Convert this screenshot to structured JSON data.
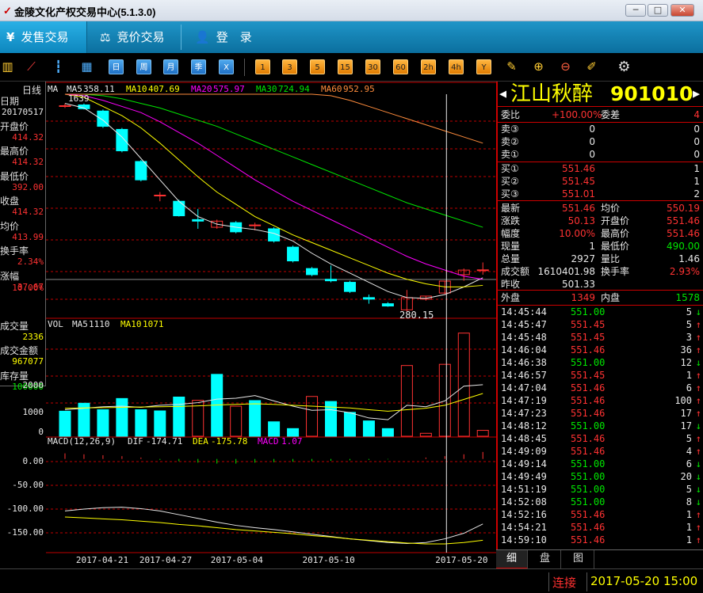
{
  "window": {
    "title": "金陵文化产权交易中心(5.1.3.0)",
    "minimize": "─",
    "restore": "□",
    "close": "✕"
  },
  "nav": {
    "tabs": [
      {
        "label": "发售交易",
        "icon": "¥"
      },
      {
        "label": "竞价交易",
        "icon": "⚖"
      },
      {
        "label": "登　录",
        "icon": "👤"
      }
    ]
  },
  "toolbar": {
    "buttons": [
      "日",
      "周",
      "月",
      "季",
      "X"
    ],
    "periods": [
      "1",
      "3",
      "5",
      "15",
      "30",
      "60",
      "2h",
      "4h",
      "Y"
    ]
  },
  "left_panel": {
    "period_label": "日线",
    "fields": [
      {
        "label": "日期",
        "value": "20170517",
        "color": "white"
      },
      {
        "label": "开盘价",
        "value": "414.32",
        "color": "red"
      },
      {
        "label": "最高价",
        "value": "414.32",
        "color": "red"
      },
      {
        "label": "最低价",
        "value": "392.00",
        "color": "red"
      },
      {
        "label": "收盘",
        "value": "414.32",
        "color": "red"
      },
      {
        "label": "均价",
        "value": "413.99",
        "color": "red"
      },
      {
        "label": "换手率",
        "value": "2.34%",
        "color": "red"
      },
      {
        "label": "涨幅",
        "value": "37.67",
        "color": "red"
      },
      {
        "label": "",
        "value": "10.00%",
        "color": "red"
      },
      {
        "label": "成交量",
        "value": "2336",
        "color": "yellow"
      },
      {
        "label": "成交金额",
        "value": "967077",
        "color": "yellow"
      },
      {
        "label": "库存量",
        "value": "100000",
        "color": "green"
      }
    ]
  },
  "chart_data": [
    {
      "type": "candlestick",
      "legend": [
        {
          "name": "MA",
          "value": "",
          "color": "#e8e8e8"
        },
        {
          "name": "MA5",
          "value": "358.11",
          "color": "#e8e8e8"
        },
        {
          "name": "MA10",
          "value": "407.69",
          "color": "#ffff00"
        },
        {
          "name": "MA20",
          "value": "575.97",
          "color": "#ff00ff"
        },
        {
          "name": "MA30",
          "value": "724.94",
          "color": "#00e600"
        },
        {
          "name": "MA60",
          "value": "952.95",
          "color": "#ff8c3c"
        }
      ],
      "max_label": "1639",
      "min_label": "280.15",
      "y_range": [
        240,
        1700
      ],
      "candles": [
        {
          "o": 1620,
          "h": 1639,
          "l": 1610,
          "c": 1625
        },
        {
          "o": 1630,
          "h": 1639,
          "l": 1600,
          "c": 1605
        },
        {
          "o": 1590,
          "h": 1600,
          "l": 1480,
          "c": 1490
        },
        {
          "o": 1470,
          "h": 1480,
          "l": 1320,
          "c": 1330
        },
        {
          "o": 1260,
          "h": 1270,
          "l": 1130,
          "c": 1140
        },
        {
          "o": 1040,
          "h": 1060,
          "l": 1000,
          "c": 1040
        },
        {
          "o": 1000,
          "h": 1010,
          "l": 900,
          "c": 905
        },
        {
          "o": 880,
          "h": 950,
          "l": 820,
          "c": 870
        },
        {
          "o": 830,
          "h": 880,
          "l": 820,
          "c": 870
        },
        {
          "o": 860,
          "h": 870,
          "l": 790,
          "c": 800
        },
        {
          "o": 840,
          "h": 860,
          "l": 810,
          "c": 845
        },
        {
          "o": 820,
          "h": 830,
          "l": 730,
          "c": 740
        },
        {
          "o": 700,
          "h": 710,
          "l": 600,
          "c": 610
        },
        {
          "o": 560,
          "h": 570,
          "l": 510,
          "c": 520
        },
        {
          "o": 490,
          "h": 580,
          "l": 470,
          "c": 480
        },
        {
          "o": 470,
          "h": 480,
          "l": 400,
          "c": 410
        },
        {
          "o": 370,
          "h": 390,
          "l": 330,
          "c": 360
        },
        {
          "o": 330,
          "h": 340,
          "l": 310,
          "c": 315
        },
        {
          "o": 290,
          "h": 420,
          "l": 280,
          "c": 370
        },
        {
          "o": 360,
          "h": 380,
          "l": 350,
          "c": 380
        },
        {
          "o": 400,
          "h": 480,
          "l": 390,
          "c": 478
        },
        {
          "o": 520,
          "h": 560,
          "l": 480,
          "c": 550
        },
        {
          "o": 551.46,
          "h": 600,
          "l": 520,
          "c": 551.46
        }
      ],
      "ma5": [
        1640,
        1610,
        1530,
        1420,
        1280,
        1140,
        1000,
        900,
        850,
        830,
        815,
        790,
        740,
        660,
        590,
        530,
        470,
        410,
        370,
        365,
        390,
        440,
        500
      ],
      "ma10": [
        1700,
        1680,
        1620,
        1560,
        1480,
        1380,
        1270,
        1160,
        1060,
        980,
        900,
        840,
        780,
        730,
        680,
        630,
        580,
        530,
        490,
        460,
        440,
        440,
        450
      ],
      "ma20": [
        1700,
        1690,
        1660,
        1620,
        1580,
        1520,
        1450,
        1380,
        1300,
        1220,
        1140,
        1070,
        1000,
        940,
        880,
        820,
        760,
        700,
        640,
        590,
        550,
        510,
        490
      ],
      "ma30": [
        1700,
        1700,
        1690,
        1670,
        1640,
        1610,
        1570,
        1530,
        1490,
        1440,
        1390,
        1340,
        1290,
        1240,
        1190,
        1140,
        1090,
        1040,
        990,
        950,
        910,
        870,
        830
      ],
      "ma60": [
        1700,
        1700,
        1700,
        1700,
        1700,
        1700,
        1700,
        1700,
        1700,
        1700,
        1700,
        1700,
        1700,
        1700,
        1690,
        1660,
        1620,
        1580,
        1540,
        1500,
        1460,
        1420,
        1380
      ]
    },
    {
      "type": "bar",
      "legend": [
        {
          "name": "VOL",
          "value": "",
          "color": "#e8e8e8"
        },
        {
          "name": "MA5",
          "value": "1110",
          "color": "#e8e8e8"
        },
        {
          "name": "MA10",
          "value": "1071",
          "color": "#ffff00"
        }
      ],
      "y_ticks": [
        "0",
        "1000",
        "2000"
      ],
      "ylim": [
        0,
        3600
      ],
      "values": [
        850,
        1120,
        900,
        1280,
        900,
        860,
        1330,
        1220,
        2100,
        1020,
        1210,
        490,
        260,
        1350,
        1180,
        810,
        520,
        260,
        2400,
        100,
        2440,
        3500,
        200
      ],
      "up": [
        false,
        false,
        false,
        false,
        false,
        false,
        false,
        true,
        false,
        true,
        false,
        false,
        false,
        true,
        false,
        false,
        false,
        false,
        true,
        true,
        true,
        true,
        true
      ],
      "ma5": [
        900,
        950,
        1000,
        1020,
        980,
        1050,
        1080,
        1140,
        1260,
        1290,
        1380,
        1200,
        1020,
        880,
        900,
        800,
        620,
        560,
        1050,
        1000,
        1200,
        1700,
        1750
      ],
      "ma10": [
        950,
        960,
        970,
        980,
        990,
        1000,
        1010,
        1030,
        1060,
        1080,
        1100,
        1080,
        1050,
        1020,
        990,
        960,
        900,
        850,
        900,
        950,
        1050,
        1250,
        1450
      ]
    },
    {
      "type": "line",
      "legend": [
        {
          "name": "MACD(12,26,9)",
          "value": "",
          "color": "#e8e8e8"
        },
        {
          "name": "DIF",
          "value": "-174.71",
          "color": "#e8e8e8"
        },
        {
          "name": "DEA",
          "value": "-175.78",
          "color": "#ffff00"
        },
        {
          "name": "MACD",
          "value": "1.07",
          "color": "#ff00ff"
        }
      ],
      "y_ticks": [
        "0.00",
        "-50.00",
        "-100.00",
        "-150.00"
      ],
      "ylim": [
        -200,
        25
      ],
      "dif": [
        -112,
        -108,
        -105,
        -104,
        -107,
        -112,
        -120,
        -128,
        -136,
        -143,
        -148,
        -152,
        -157,
        -162,
        -167,
        -172,
        -176,
        -180,
        -182,
        -180,
        -172,
        -160,
        -140
      ],
      "dea": [
        -125,
        -127,
        -129,
        -131,
        -134,
        -137,
        -141,
        -144,
        -148,
        -152,
        -155,
        -158,
        -161,
        -165,
        -168,
        -172,
        -175,
        -178,
        -181,
        -183,
        -183,
        -180,
        -175
      ],
      "macd": [
        12,
        10,
        8,
        6,
        3,
        -2,
        -5,
        -8,
        -10,
        -10,
        -8,
        -7,
        -6,
        -5,
        -4,
        -3,
        -2,
        -1,
        0,
        3,
        6,
        10,
        15
      ]
    }
  ],
  "x_labels": [
    "2017-04-21",
    "2017-04-27",
    "2017-05-04",
    "2017-05-10",
    "2017-05-20"
  ],
  "stock": {
    "name": "江山秋醉",
    "code": "901010"
  },
  "quote": {
    "weibi_label": "委比",
    "weibi": "+100.00%",
    "weicha_label": "委差",
    "weicha": "4",
    "asks": [
      {
        "label": "卖③",
        "price": "0",
        "vol": "0"
      },
      {
        "label": "卖②",
        "price": "0",
        "vol": "0"
      },
      {
        "label": "卖①",
        "price": "0",
        "vol": "0"
      }
    ],
    "bids": [
      {
        "label": "买①",
        "price": "551.46",
        "vol": "1"
      },
      {
        "label": "买②",
        "price": "551.45",
        "vol": "1"
      },
      {
        "label": "买③",
        "price": "551.01",
        "vol": "2"
      }
    ],
    "stats": [
      {
        "l1": "最新",
        "v1": "551.46",
        "c1": "red",
        "l2": "均价",
        "v2": "550.19",
        "c2": "red"
      },
      {
        "l1": "涨跌",
        "v1": "50.13",
        "c1": "red",
        "l2": "开盘价",
        "v2": "551.46",
        "c2": "red"
      },
      {
        "l1": "幅度",
        "v1": "10.00%",
        "c1": "red",
        "l2": "最高价",
        "v2": "551.46",
        "c2": "red"
      },
      {
        "l1": "现量",
        "v1": "1",
        "c1": "white",
        "l2": "最低价",
        "v2": "490.00",
        "c2": "green"
      },
      {
        "l1": "总量",
        "v1": "2927",
        "c1": "white",
        "l2": "量比",
        "v2": "1.46",
        "c2": "white"
      },
      {
        "l1": "成交额",
        "v1": "1610401.98",
        "c1": "white",
        "l2": "换手率",
        "v2": "2.93%",
        "c2": "red"
      },
      {
        "l1": "昨收",
        "v1": "501.33",
        "c1": "white",
        "l2": "",
        "v2": "",
        "c2": "white"
      }
    ],
    "outer_label": "外盘",
    "outer": "1349",
    "inner_label": "内盘",
    "inner": "1578"
  },
  "ticks": [
    {
      "t": "14:45:44",
      "p": "551.00",
      "pc": "green",
      "v": "5",
      "d": "↓",
      "dc": "green"
    },
    {
      "t": "14:45:47",
      "p": "551.45",
      "pc": "red",
      "v": "5",
      "d": "↑",
      "dc": "red"
    },
    {
      "t": "14:45:48",
      "p": "551.45",
      "pc": "red",
      "v": "3",
      "d": "↑",
      "dc": "red"
    },
    {
      "t": "14:46:04",
      "p": "551.46",
      "pc": "red",
      "v": "36",
      "d": "↑",
      "dc": "red"
    },
    {
      "t": "14:46:38",
      "p": "551.00",
      "pc": "green",
      "v": "12",
      "d": "↓",
      "dc": "green"
    },
    {
      "t": "14:46:57",
      "p": "551.45",
      "pc": "red",
      "v": "1",
      "d": "↑",
      "dc": "red"
    },
    {
      "t": "14:47:04",
      "p": "551.46",
      "pc": "red",
      "v": "6",
      "d": "↑",
      "dc": "red"
    },
    {
      "t": "14:47:19",
      "p": "551.46",
      "pc": "red",
      "v": "100",
      "d": "↑",
      "dc": "red"
    },
    {
      "t": "14:47:23",
      "p": "551.46",
      "pc": "red",
      "v": "17",
      "d": "↑",
      "dc": "red"
    },
    {
      "t": "14:48:12",
      "p": "551.00",
      "pc": "green",
      "v": "17",
      "d": "↓",
      "dc": "green"
    },
    {
      "t": "14:48:45",
      "p": "551.46",
      "pc": "red",
      "v": "5",
      "d": "↑",
      "dc": "red"
    },
    {
      "t": "14:49:09",
      "p": "551.46",
      "pc": "red",
      "v": "4",
      "d": "↑",
      "dc": "red"
    },
    {
      "t": "14:49:14",
      "p": "551.00",
      "pc": "green",
      "v": "6",
      "d": "↓",
      "dc": "green"
    },
    {
      "t": "14:49:49",
      "p": "551.00",
      "pc": "green",
      "v": "20",
      "d": "↓",
      "dc": "green"
    },
    {
      "t": "14:51:19",
      "p": "551.00",
      "pc": "green",
      "v": "5",
      "d": "↓",
      "dc": "green"
    },
    {
      "t": "14:52:08",
      "p": "551.00",
      "pc": "green",
      "v": "8",
      "d": "↓",
      "dc": "green"
    },
    {
      "t": "14:52:16",
      "p": "551.46",
      "pc": "red",
      "v": "1",
      "d": "↑",
      "dc": "red"
    },
    {
      "t": "14:54:21",
      "p": "551.46",
      "pc": "red",
      "v": "1",
      "d": "↑",
      "dc": "red"
    },
    {
      "t": "14:59:10",
      "p": "551.46",
      "pc": "red",
      "v": "1",
      "d": "↑",
      "dc": "red"
    }
  ],
  "bottom_tabs": [
    "细",
    "盘",
    "图"
  ],
  "status": {
    "connection": "连接",
    "datetime": "2017-05-20 15:00"
  },
  "colors": {
    "up": "#ff3232",
    "down": "#00ffff",
    "grid": "#c00000",
    "ma5": "#e8e8e8",
    "ma10": "#ffff00",
    "ma20": "#ff00ff",
    "ma30": "#00e600",
    "ma60": "#ff8c3c"
  }
}
